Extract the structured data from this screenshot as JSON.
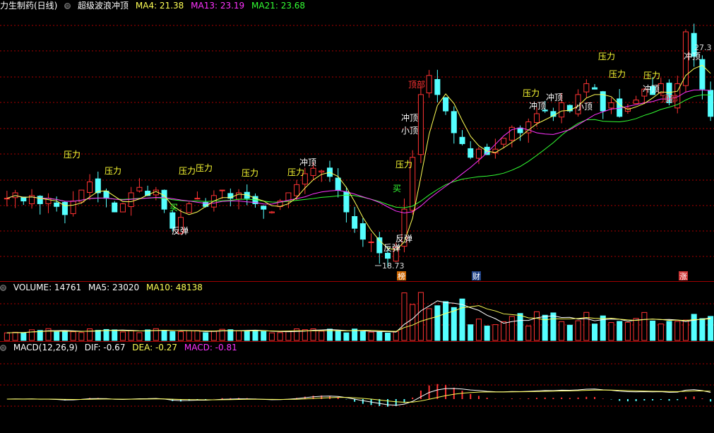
{
  "main": {
    "title": "力生制药(日线)",
    "indicator": "超级波浪冲顶",
    "ma4_label": "MA4: 21.38",
    "ma13_label": "MA13: 23.19",
    "ma21_label": "MA21: 23.68",
    "high_label": "27.3",
    "low_label": "18.73",
    "markers": [
      "榜",
      "财",
      "涨"
    ]
  },
  "volume": {
    "label": "VOLUME: 14761",
    "ma5_label": "MA5: 23020",
    "ma10_label": "MA10: 48138"
  },
  "macd": {
    "label": "MACD(12,26,9)",
    "dif_label": "DIF: -0.67",
    "dea_label": "DEA: -0.27",
    "macd_label": "MACD: -0.81"
  },
  "colors": {
    "up": "#ff3333",
    "down": "#55ffff",
    "ma4": "#ffff55",
    "ma13": "#ff33ff",
    "ma21": "#33ff33",
    "grid": "#aa0000",
    "signal_yellow": "#ffff33"
  },
  "annotations": {
    "pressure": "压力",
    "top": "冲顶",
    "small_top": "小顶",
    "peak": "顶部",
    "rebound": "反弹",
    "buy": "买"
  },
  "chart_data": {
    "type": "candlestick",
    "closes": [
      21.0,
      21.2,
      20.9,
      21.1,
      20.8,
      21.0,
      20.7,
      20.4,
      20.9,
      21.3,
      21.6,
      21.2,
      21.0,
      20.5,
      20.8,
      21.2,
      21.4,
      21.1,
      21.3,
      20.6,
      19.9,
      20.3,
      20.8,
      21.0,
      20.7,
      21.1,
      21.3,
      21.0,
      21.2,
      21.0,
      20.8,
      20.6,
      20.5,
      20.9,
      21.2,
      21.5,
      21.9,
      22.1,
      22.0,
      21.8,
      21.3,
      20.5,
      19.9,
      19.5,
      19.4,
      19.0,
      18.8,
      19.2,
      20.6,
      22.5,
      24.8,
      25.5,
      24.8,
      24.2,
      23.4,
      23.0,
      22.5,
      22.8,
      22.6,
      22.8,
      23.2,
      23.6,
      23.4,
      23.8,
      24.1,
      24.2,
      24.0,
      24.5,
      24.2,
      24.8,
      25.2,
      25.0,
      24.2,
      24.5,
      24.0,
      24.3,
      24.6,
      25.0,
      24.8,
      25.2,
      24.5,
      25.2,
      27.1,
      26.2,
      25.0,
      24.0
    ],
    "low": 18.73,
    "high": 27.3,
    "ma4": 21.38,
    "ma13": 23.19,
    "ma21": 23.68,
    "volume_latest": 14761,
    "volume_ma5": 23020,
    "volume_ma10": 48138,
    "dif": -0.67,
    "dea": -0.27,
    "macd": -0.81
  }
}
